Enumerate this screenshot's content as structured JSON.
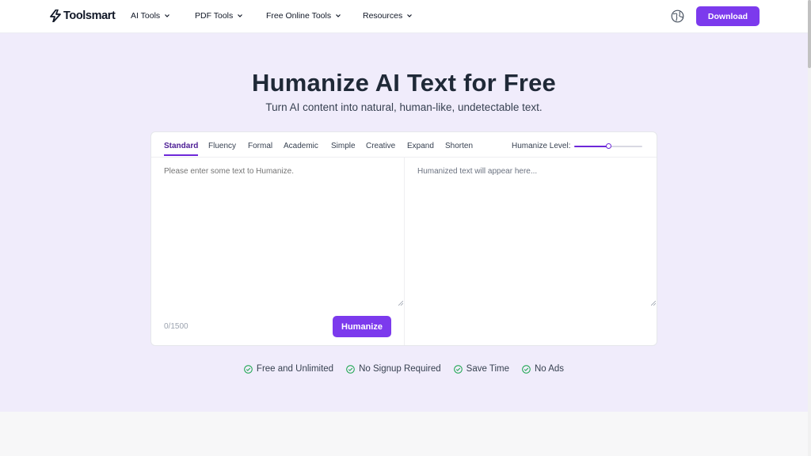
{
  "header": {
    "logo_text": "Toolsmart",
    "nav": [
      {
        "label": "AI Tools"
      },
      {
        "label": "PDF Tools"
      },
      {
        "label": "Free Online Tools"
      },
      {
        "label": "Resources"
      }
    ],
    "download_label": "Download"
  },
  "hero": {
    "title": "Humanize AI Text for Free",
    "subtitle": "Turn AI content into natural, human-like, undetectable text."
  },
  "editor": {
    "tabs": [
      {
        "label": "Standard",
        "active": true
      },
      {
        "label": "Fluency"
      },
      {
        "label": "Formal"
      },
      {
        "label": "Academic"
      },
      {
        "label": "Simple"
      },
      {
        "label": "Creative"
      },
      {
        "label": "Expand"
      },
      {
        "label": "Shorten"
      }
    ],
    "level_label": "Humanize Level:",
    "level_value": 0.5,
    "input_placeholder": "Please enter some text to Humanize.",
    "output_placeholder": "Humanized text will appear here...",
    "counter": "0/1500",
    "humanize_label": "Humanize"
  },
  "features": [
    {
      "label": "Free and Unlimited"
    },
    {
      "label": "No Signup Required"
    },
    {
      "label": "Save Time"
    },
    {
      "label": "No Ads"
    }
  ],
  "colors": {
    "accent": "#7c3aed",
    "hero_bg": "#f0ecfb",
    "check": "#16a34a"
  },
  "icons": {
    "logo": "bolt-logo-icon",
    "nav_chevron": "chevron-down-icon",
    "language": "globe-icon",
    "feature": "check-circle-icon"
  }
}
